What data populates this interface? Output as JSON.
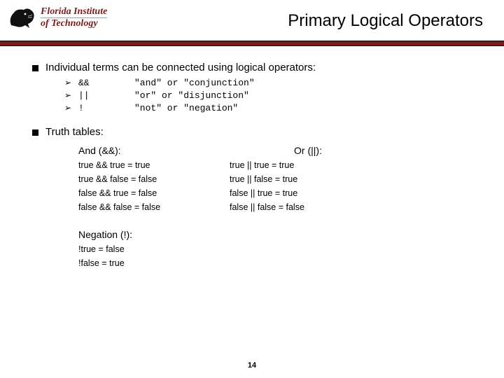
{
  "header": {
    "institution_line1": "Florida Institute",
    "institution_line2": "of Technology",
    "title": "Primary Logical Operators"
  },
  "bullets": {
    "intro": "Individual terms can be connected using logical operators:",
    "operators": [
      {
        "symbol": "&&",
        "desc": "\"and\" or \"conjunction\""
      },
      {
        "symbol": "||",
        "desc": "\"or\" or \"disjunction\""
      },
      {
        "symbol": "!",
        "desc": "\"not\" or \"negation\""
      }
    ],
    "truth_heading": "Truth tables:"
  },
  "tables": {
    "and": {
      "title": "And (&&):",
      "rows": [
        "true && true = true",
        "true && false = false",
        "false && true = false",
        "false && false = false"
      ]
    },
    "or": {
      "title": "Or (||):",
      "rows": [
        "true || true = true",
        "true || false = true",
        "false || true = true",
        "false || false = false"
      ]
    },
    "neg": {
      "title": "Negation (!):",
      "rows": [
        "!true = false",
        "!false = true"
      ]
    }
  },
  "page_number": "14"
}
